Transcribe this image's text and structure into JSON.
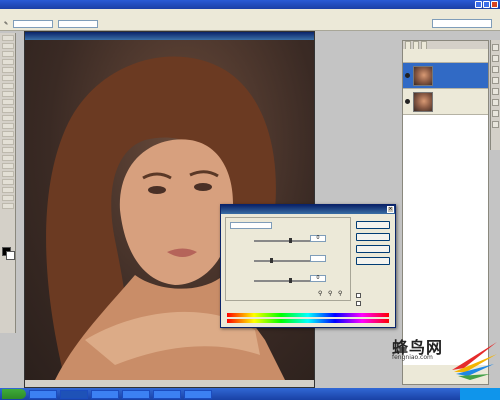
{
  "app": {
    "window_title": "",
    "accent": "#1b3fa6"
  },
  "dialog": {
    "title": "",
    "ok_label": "",
    "cancel_label": "",
    "load_label": "",
    "save_label": "",
    "preview_label": "",
    "field_values": [
      "0",
      "",
      "0"
    ]
  },
  "layers": {
    "items": [
      {
        "label": ""
      },
      {
        "label": ""
      }
    ]
  },
  "watermark": {
    "brand": "蜂鸟网",
    "url": "fengniao.com"
  },
  "taskbar": {
    "items": [
      "",
      "",
      "",
      "",
      "",
      ""
    ]
  }
}
